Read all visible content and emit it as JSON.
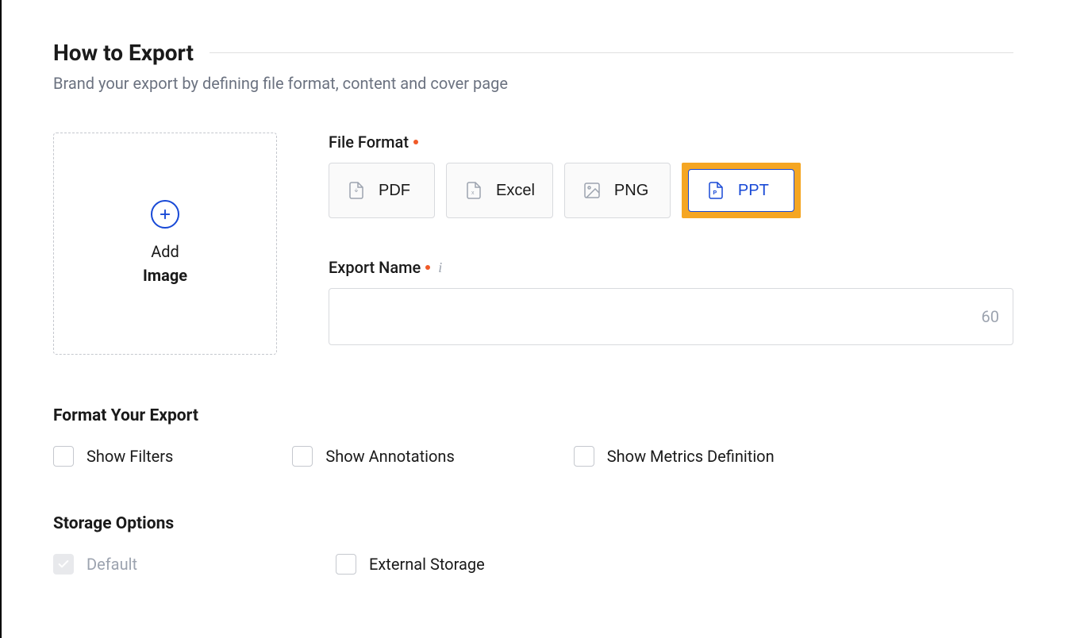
{
  "header": {
    "title": "How to Export",
    "subtitle": "Brand your export by defining file format, content and cover page"
  },
  "addImage": {
    "line1": "Add",
    "line2": "Image"
  },
  "fileFormat": {
    "label": "File Format",
    "options": {
      "pdf": "PDF",
      "excel": "Excel",
      "png": "PNG",
      "ppt": "PPT"
    }
  },
  "exportName": {
    "label": "Export Name",
    "value": "",
    "counter": "60"
  },
  "formatSection": {
    "heading": "Format Your Export",
    "showFilters": "Show Filters",
    "showAnnotations": "Show Annotations",
    "showMetricsDefinition": "Show Metrics Definition"
  },
  "storageSection": {
    "heading": "Storage Options",
    "default": "Default",
    "external": "External Storage"
  }
}
